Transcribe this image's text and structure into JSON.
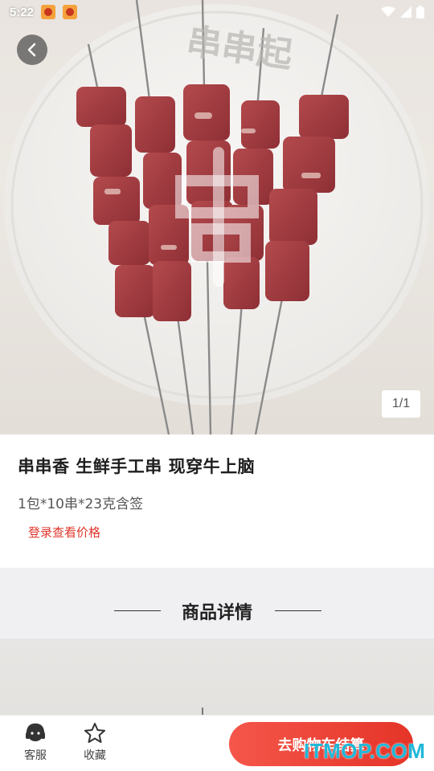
{
  "status_bar": {
    "time": "5:22"
  },
  "gallery": {
    "indicator": "1/1",
    "image_brand": "串串起"
  },
  "product": {
    "title": "串串香 生鲜手工串 现穿牛上脑",
    "spec": "1包*10串*23克含签",
    "price_login": "登录查看价格"
  },
  "details": {
    "title": "商品详情"
  },
  "bottom_bar": {
    "service_label": "客服",
    "favorite_label": "收藏",
    "cart_button": "去购物车结算"
  },
  "watermark": "ITMOP.COM",
  "colors": {
    "accent": "#e53428",
    "price_text": "#e0352b",
    "section_bg": "#f0f0f3"
  },
  "icons": [
    "back-arrow-icon",
    "headset-icon",
    "star-icon",
    "wifi-icon",
    "signal-icon",
    "battery-icon"
  ]
}
